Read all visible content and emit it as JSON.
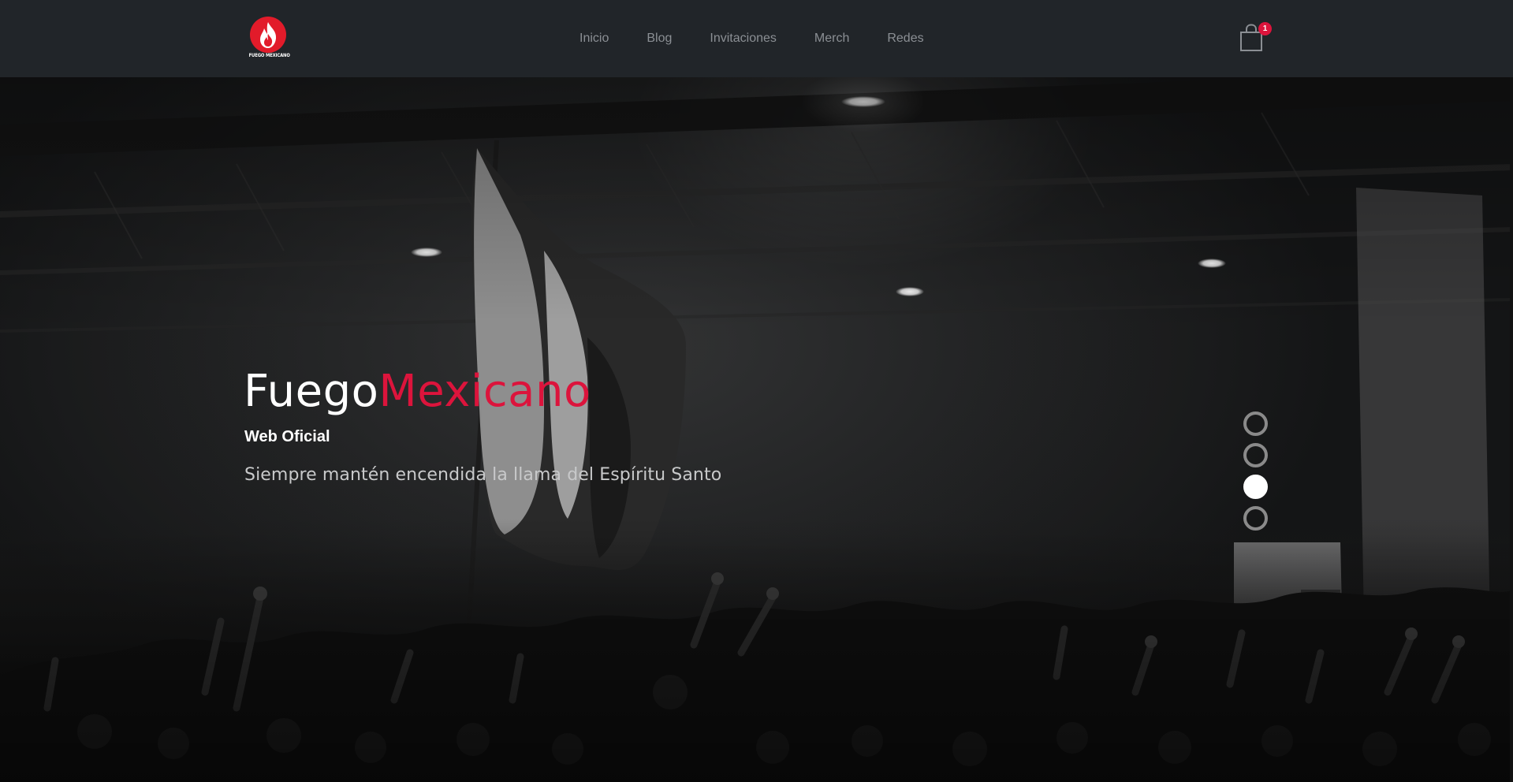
{
  "brand": {
    "logo_text": "FUEGO MEXICANO",
    "logo_icon": "flame-icon",
    "accent_color": "#dc143c"
  },
  "nav": {
    "items": [
      {
        "label": "Inicio"
      },
      {
        "label": "Blog"
      },
      {
        "label": "Invitaciones"
      },
      {
        "label": "Merch"
      },
      {
        "label": "Redes"
      }
    ]
  },
  "cart": {
    "icon": "shopping-bag-icon",
    "count": "1"
  },
  "hero": {
    "title_part1": "Fuego",
    "title_part2": "Mexicano",
    "subtitle": "Web Oficial",
    "tagline": "Siempre mantén encendida la llama del Espíritu Santo",
    "background": "black-and-white worship crowd photo with Mexican flag",
    "slides": 4,
    "active_slide": 3
  }
}
